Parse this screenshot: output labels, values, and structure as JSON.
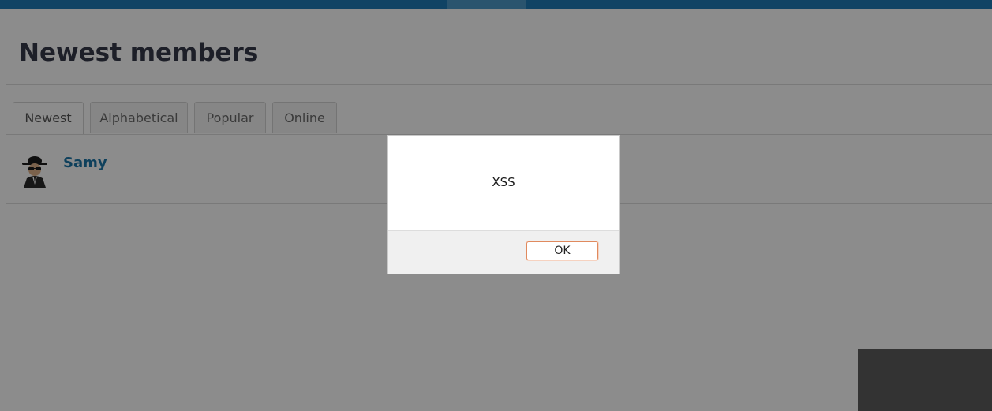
{
  "page": {
    "title": "Newest members"
  },
  "tabs": [
    {
      "label": "Newest",
      "active": true
    },
    {
      "label": "Alphabetical",
      "active": false
    },
    {
      "label": "Popular",
      "active": false
    },
    {
      "label": "Online",
      "active": false
    }
  ],
  "members": [
    {
      "name": "Samy",
      "avatar_icon": "spy-avatar-icon"
    }
  ],
  "dialog": {
    "message": "XSS",
    "ok_label": "OK"
  },
  "colors": {
    "topbar": "#1e7bb6",
    "link": "#1a75a8",
    "ok_border": "#e08a5e"
  }
}
